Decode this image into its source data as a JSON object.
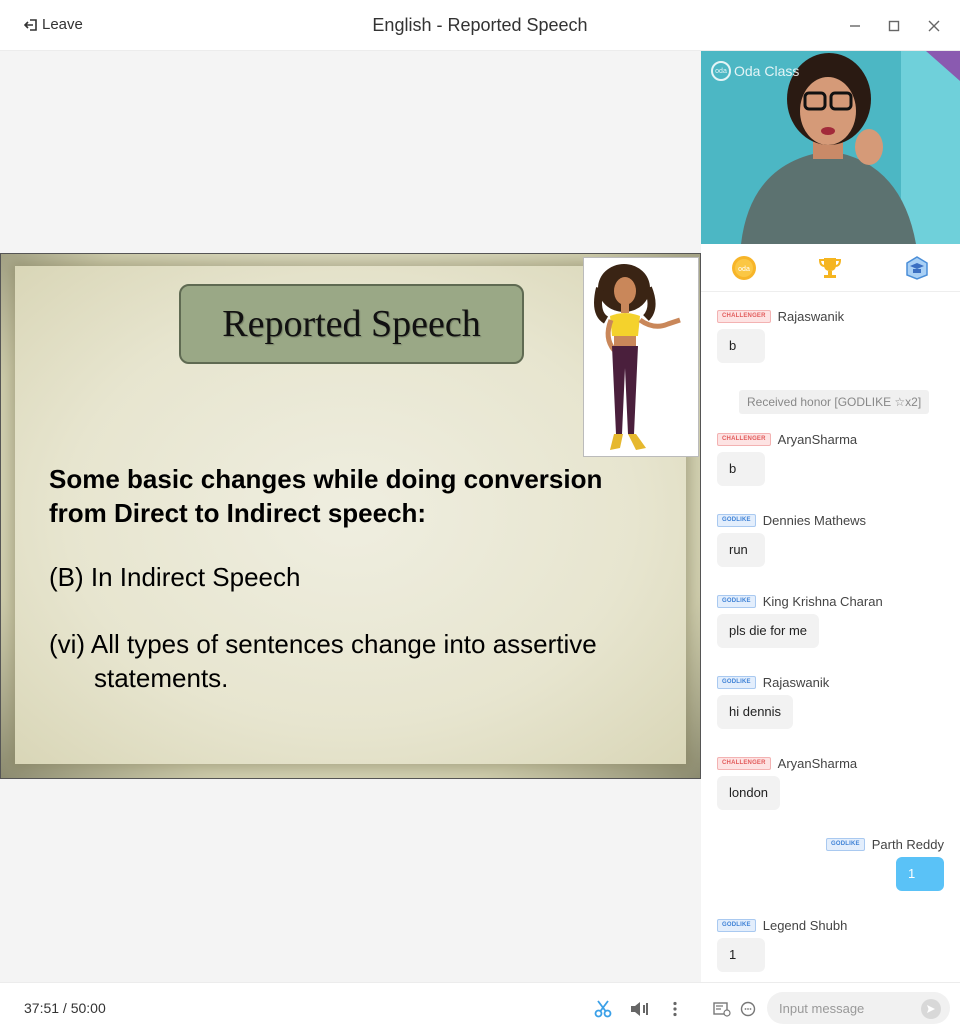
{
  "header": {
    "leave_label": "Leave",
    "title": "English - Reported Speech"
  },
  "slide": {
    "title": "Reported Speech",
    "line1": "Some basic changes while doing conversion from Direct to Indirect speech:",
    "line2": "(B) In Indirect Speech",
    "line3": "(vi)  All types of sentences change into assertive statements."
  },
  "video": {
    "brand": "Oda Class",
    "brand_icon": "oda"
  },
  "bottom": {
    "timer": "37:51  / 50:00"
  },
  "chat": {
    "system_message": "Received honor [GODLIKE ☆x2]",
    "messages": [
      {
        "badge": "CHALLENGER",
        "user": "Rajaswanik",
        "text": "b"
      },
      {
        "badge": "CHALLENGER",
        "user": "AryanSharma",
        "text": "b"
      },
      {
        "badge": "GODLIKE",
        "user": "Dennies Mathews",
        "text": "run"
      },
      {
        "badge": "GODLIKE",
        "user": "King Krishna Charan",
        "text": "pls die for me"
      },
      {
        "badge": "GODLIKE",
        "user": "Rajaswanik",
        "text": "hi dennis"
      },
      {
        "badge": "CHALLENGER",
        "user": "AryanSharma",
        "text": "london"
      },
      {
        "badge": "GODLIKE",
        "user": "Parth Reddy",
        "text": "1"
      },
      {
        "badge": "GODLIKE",
        "user": "Legend Shubh",
        "text": "1"
      }
    ]
  },
  "input": {
    "placeholder": "Input message"
  },
  "colors": {
    "accent": "#5ac2f7",
    "challenger": "#e25b5b",
    "godlike": "#3f82d6",
    "slide_title_box": "#9aa886"
  }
}
